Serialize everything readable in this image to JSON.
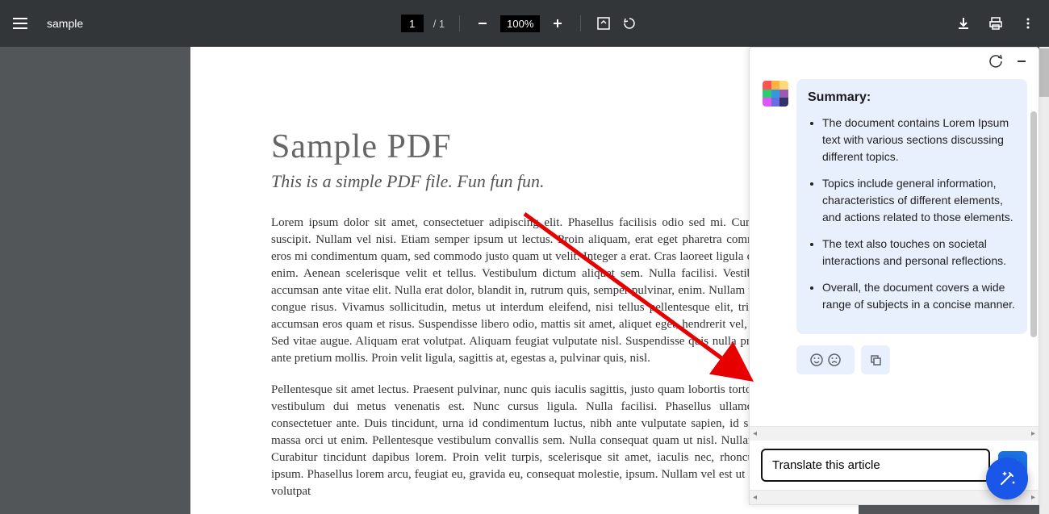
{
  "toolbar": {
    "title": "sample",
    "page_current": "1",
    "page_total": "/  1",
    "zoom": "100%"
  },
  "pdf": {
    "title": "Sample PDF",
    "subtitle": "This is a simple PDF file. Fun fun fun.",
    "para1": "Lorem ipsum dolor sit amet, consectetuer adipiscing elit. Phasellus facilisis odio sed mi. Curabitur suscipit. Nullam vel nisi. Etiam semper ipsum ut lectus. Proin aliquam, erat eget pharetra commodo, eros mi condimentum quam, sed commodo justo quam ut velit. Integer a erat. Cras laoreet ligula cursus enim. Aenean scelerisque velit et tellus. Vestibulum dictum aliquet sem. Nulla facilisi. Vestibulum accumsan ante vitae elit. Nulla erat dolor, blandit in, rutrum quis, semper pulvinar, enim. Nullam varius congue risus. Vivamus sollicitudin, metus ut interdum eleifend, nisi tellus pellentesque elit, tristique accumsan eros quam et risus. Suspendisse libero odio, mattis sit amet, aliquet eget, hendrerit vel, nulla. Sed vitae augue. Aliquam erat volutpat. Aliquam feugiat vulputate nisl. Suspendisse quis nulla pretium ante pretium mollis. Proin velit ligula, sagittis at, egestas a, pulvinar quis, nisl.",
    "para2": "Pellentesque sit amet lectus. Praesent pulvinar, nunc quis iaculis sagittis, justo quam lobortis tortor, sed vestibulum dui metus venenatis est. Nunc cursus ligula. Nulla facilisi. Phasellus ullamcorper consectetuer ante. Duis tincidunt, urna id condimentum luctus, nibh ante vulputate sapien, id sagittis massa orci ut enim. Pellentesque vestibulum convallis sem. Nulla consequat quam ut nisl. Nullam est. Curabitur tincidunt dapibus lorem. Proin velit turpis, scelerisque sit amet, iaculis nec, rhoncus ac, ipsum. Phasellus lorem arcu, feugiat eu, gravida eu, consequat molestie, ipsum. Nullam vel est ut ipsum volutpat"
  },
  "sidebar": {
    "summary_title": "Summary:",
    "points": [
      "The document contains Lorem Ipsum text with various sections discussing different topics.",
      "Topics include general information, characteristics of different elements, and actions related to those elements.",
      "The text also touches on societal interactions and personal reflections.",
      "Overall, the document covers a wide range of subjects in a concise manner."
    ],
    "input_value": "Translate this article"
  }
}
